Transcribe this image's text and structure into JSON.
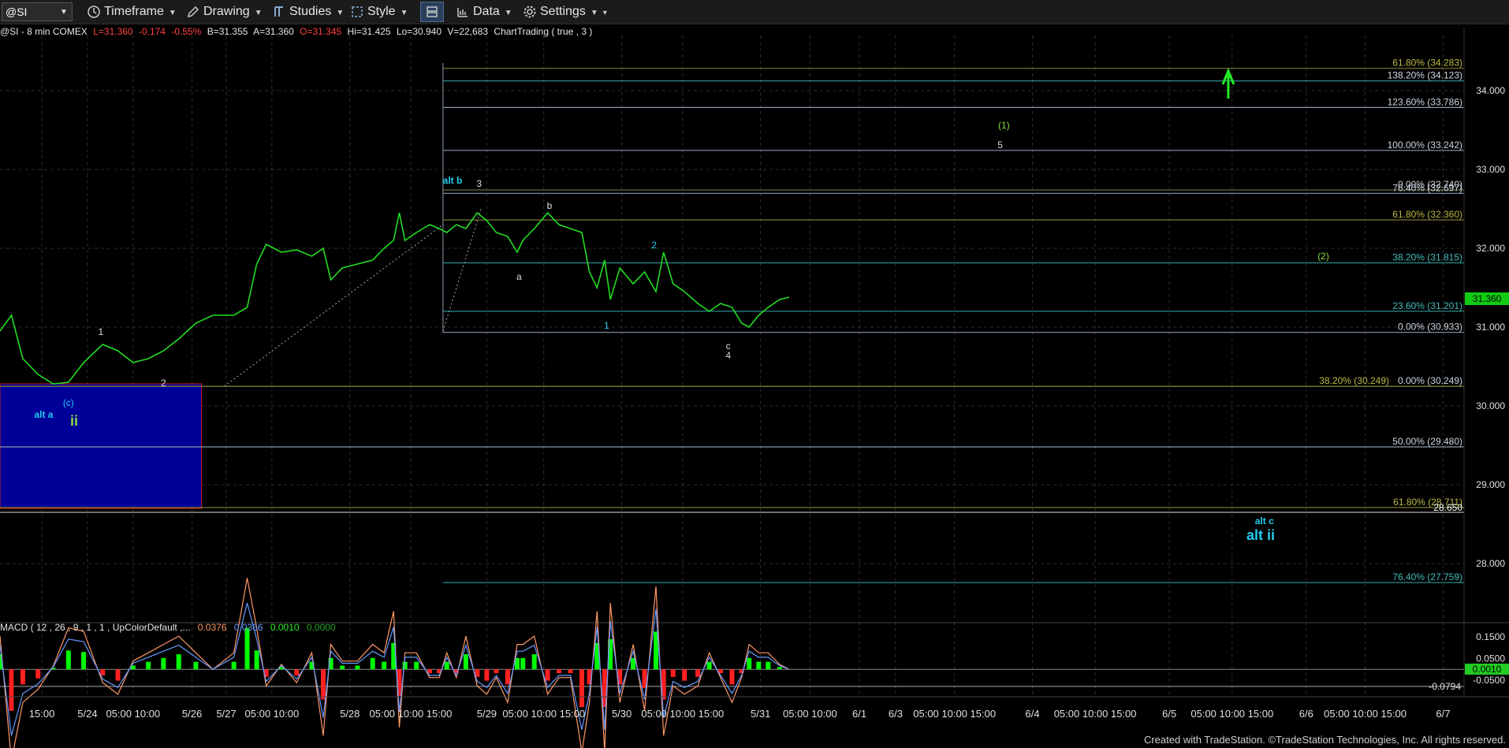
{
  "toolbar": {
    "symbol": "@SI",
    "timeframe": "Timeframe",
    "drawing": "Drawing",
    "studies": "Studies",
    "style": "Style",
    "data": "Data",
    "settings": "Settings"
  },
  "status": {
    "label": "@SI - 8 min  COMEX",
    "last": "L=31.360",
    "change": "-0.174",
    "pct": "-0.55%",
    "bid": "B=31.355",
    "ask": "A=31.360",
    "open": "O=31.345",
    "high": "Hi=31.425",
    "low": "Lo=30.940",
    "volume": "V=22,683",
    "study": "ChartTrading ( true , 3 )"
  },
  "colors": {
    "price": "#22dd22",
    "up": "#00ff00",
    "down": "#ff2020",
    "macd_blue": "#6699ff",
    "macd_orange": "#ff9966",
    "grid": "#2e2e2e",
    "box": "#000099",
    "label_cyan": "#22ccee",
    "label_green": "#88dd44"
  },
  "chart_data": {
    "type": "line",
    "series": [
      {
        "values": [
          [
            0.0,
            30.95
          ],
          [
            0.6,
            31.15
          ],
          [
            1.2,
            30.6
          ],
          [
            2.0,
            30.4
          ],
          [
            2.8,
            30.28
          ],
          [
            3.6,
            30.3
          ],
          [
            4.4,
            30.55
          ],
          [
            5.4,
            30.78
          ],
          [
            6.2,
            30.7
          ],
          [
            7.0,
            30.55
          ],
          [
            7.8,
            30.6
          ],
          [
            8.6,
            30.7
          ],
          [
            9.4,
            30.85
          ],
          [
            10.3,
            31.05
          ],
          [
            11.2,
            31.15
          ],
          [
            12.3,
            31.15
          ],
          [
            13.0,
            31.25
          ],
          [
            13.5,
            31.8
          ],
          [
            14.0,
            32.05
          ],
          [
            14.8,
            31.95
          ],
          [
            15.6,
            31.98
          ],
          [
            16.4,
            31.9
          ],
          [
            17.0,
            32.0
          ],
          [
            17.4,
            31.6
          ],
          [
            18.0,
            31.75
          ],
          [
            18.8,
            31.8
          ],
          [
            19.6,
            31.85
          ],
          [
            20.2,
            32.0
          ],
          [
            20.7,
            32.1
          ],
          [
            21.0,
            32.45
          ],
          [
            21.3,
            32.1
          ],
          [
            21.9,
            32.2
          ],
          [
            22.6,
            32.3
          ],
          [
            23.1,
            32.25
          ],
          [
            23.5,
            32.2
          ],
          [
            24.0,
            32.3
          ],
          [
            24.5,
            32.25
          ],
          [
            25.1,
            32.45
          ],
          [
            25.6,
            32.35
          ],
          [
            26.1,
            32.2
          ],
          [
            26.7,
            32.15
          ],
          [
            27.2,
            31.95
          ],
          [
            27.5,
            32.1
          ],
          [
            28.1,
            32.25
          ],
          [
            28.8,
            32.45
          ],
          [
            29.4,
            32.3
          ],
          [
            30.0,
            32.25
          ],
          [
            30.6,
            32.2
          ],
          [
            31.0,
            31.7
          ],
          [
            31.4,
            31.5
          ],
          [
            31.8,
            31.85
          ],
          [
            32.1,
            31.35
          ],
          [
            32.6,
            31.75
          ],
          [
            33.3,
            31.55
          ],
          [
            33.9,
            31.7
          ],
          [
            34.5,
            31.45
          ],
          [
            34.9,
            31.95
          ],
          [
            35.4,
            31.55
          ],
          [
            36.0,
            31.45
          ],
          [
            36.7,
            31.3
          ],
          [
            37.3,
            31.2
          ],
          [
            37.9,
            31.3
          ],
          [
            38.5,
            31.25
          ],
          [
            39.0,
            31.05
          ],
          [
            39.4,
            31.0
          ],
          [
            39.9,
            31.15
          ],
          [
            40.4,
            31.25
          ],
          [
            41.0,
            31.35
          ],
          [
            41.5,
            31.38
          ]
        ]
      }
    ],
    "xlim": [
      0,
      77
    ],
    "ylim": [
      27.3,
      34.7
    ],
    "x_ticks": [
      {
        "label": "15:00",
        "x": 2.2
      },
      {
        "label": "5/24",
        "x": 4.6
      },
      {
        "label": "05:00 10:00",
        "x": 7.0
      },
      {
        "label": "5/26",
        "x": 10.1
      },
      {
        "label": "5/27",
        "x": 11.9
      },
      {
        "label": "05:00 10:00",
        "x": 14.3
      },
      {
        "label": "5/28",
        "x": 18.4
      },
      {
        "label": "05:00 10:00 15:00",
        "x": 21.6
      },
      {
        "label": "5/29",
        "x": 25.6
      },
      {
        "label": "05:00 10:00 15:00",
        "x": 28.6
      },
      {
        "label": "5/30",
        "x": 32.7
      },
      {
        "label": "05:00 10:00 15:00",
        "x": 35.9
      },
      {
        "label": "5/31",
        "x": 40.0
      },
      {
        "label": "05:00 10:00",
        "x": 42.6
      },
      {
        "label": "6/1",
        "x": 45.2
      },
      {
        "label": "6/3",
        "x": 47.1
      },
      {
        "label": "05:00 10:00 15:00",
        "x": 50.2
      },
      {
        "label": "6/4",
        "x": 54.3
      },
      {
        "label": "05:00 10:00 15:00",
        "x": 57.6
      },
      {
        "label": "6/5",
        "x": 61.5
      },
      {
        "label": "05:00 10:00 15:00",
        "x": 64.8
      },
      {
        "label": "6/6",
        "x": 68.7
      },
      {
        "label": "05:00 10:00 15:00",
        "x": 71.8
      },
      {
        "label": "6/7",
        "x": 75.9
      }
    ],
    "y_ticks": [
      28.0,
      29.0,
      30.0,
      31.0,
      32.0,
      33.0,
      34.0
    ],
    "y_tick_labels": [
      "28.000",
      "29.000",
      "30.000",
      "31.000",
      "32.000",
      "33.000",
      "34.000"
    ],
    "last_price": "31.360",
    "fib_levels": [
      {
        "label": "61.80% (34.283)",
        "y": 34.283,
        "color": "#7a7a30"
      },
      {
        "label": "138.20% (34.123)",
        "y": 34.123,
        "color": "#3a9a9a"
      },
      {
        "label": "123.60% (33.786)",
        "y": 33.786,
        "color": "#8899aa"
      },
      {
        "label": "100.00% (33.242)",
        "y": 33.242,
        "color": "#8899aa"
      },
      {
        "label": "0.00% (32.740)",
        "y": 32.74,
        "color": "#6a6a40"
      },
      {
        "label": "76.40% (32.697)",
        "y": 32.697,
        "color": "#8899aa"
      },
      {
        "label": "61.80% (32.360)",
        "y": 32.36,
        "color": "#7a7a30"
      },
      {
        "label": "38.20% (31.815)",
        "y": 31.815,
        "color": "#2a8a8a"
      },
      {
        "label": "23.60% (31.201)",
        "y": 31.201,
        "color": "#2a8a8a"
      },
      {
        "label": "0.00% (30.933)",
        "y": 30.933,
        "color": "#8899aa"
      },
      {
        "label": "0.00% (30.249)",
        "y": 30.249,
        "color": "#8899aa"
      },
      {
        "label": "38.20% (30.249)",
        "y": 30.249,
        "color": "#7a7a30"
      },
      {
        "label": "50.00% (29.480)",
        "y": 29.48,
        "color": "#8899aa"
      },
      {
        "label": "61.80% (28.711)",
        "y": 28.711,
        "color": "#7a7a30"
      },
      {
        "label": "76.40% (27.759)",
        "y": 27.759,
        "color": "#2a8a8a"
      }
    ],
    "extra_level": {
      "label": "28.650",
      "y": 28.65
    },
    "annotations": [
      {
        "text": "1",
        "x": 5.3,
        "y": 30.9,
        "color": "#dddddd"
      },
      {
        "text": "2",
        "x": 8.6,
        "y": 30.25,
        "color": "#dddddd"
      },
      {
        "text": "(c)",
        "x": 3.6,
        "y": 30.0,
        "color": "#22ccee"
      },
      {
        "text": "alt a",
        "x": 2.3,
        "y": 29.85,
        "color": "#22ccee"
      },
      {
        "text": "ii",
        "x": 3.9,
        "y": 29.75,
        "color": "#88dd44"
      },
      {
        "text": "alt b",
        "x": 23.8,
        "y": 32.82,
        "color": "#22ccee"
      },
      {
        "text": "3",
        "x": 25.2,
        "y": 32.78,
        "color": "#dddddd"
      },
      {
        "text": "b",
        "x": 28.9,
        "y": 32.5,
        "color": "#dddddd"
      },
      {
        "text": "a",
        "x": 27.3,
        "y": 31.6,
        "color": "#dddddd"
      },
      {
        "text": "2",
        "x": 34.4,
        "y": 32.0,
        "color": "#22ccee"
      },
      {
        "text": "1",
        "x": 31.9,
        "y": 30.98,
        "color": "#22ccee"
      },
      {
        "text": "c",
        "x": 38.3,
        "y": 30.72,
        "color": "#dddddd"
      },
      {
        "text": "4",
        "x": 38.3,
        "y": 30.6,
        "color": "#dddddd"
      },
      {
        "text": "(1)",
        "x": 52.8,
        "y": 33.52,
        "color": "#88dd44"
      },
      {
        "text": "5",
        "x": 52.6,
        "y": 33.27,
        "color": "#dddddd"
      },
      {
        "text": "(2)",
        "x": 69.6,
        "y": 31.86,
        "color": "#88dd44"
      },
      {
        "text": "alt c",
        "x": 66.5,
        "y": 28.5,
        "color": "#22ccee"
      },
      {
        "text": "alt ii",
        "x": 66.3,
        "y": 28.3,
        "color": "#22ccee"
      }
    ],
    "macd": {
      "legend": "MACD ( 12 , 26 , 9 , 1 , 1 , UpColorDefault ,...",
      "values": [
        "0.0376",
        "0.0366",
        "0.0010",
        "0.0000"
      ],
      "y_ticks": [
        "0.1500",
        "0.0500",
        "-0.0500"
      ],
      "min_label": "-0.0794",
      "last_label": "0.0010",
      "ylim": [
        -0.12,
        0.18
      ]
    }
  },
  "footer": "Created with TradeStation. ©TradeStation Technologies, Inc. All rights reserved."
}
